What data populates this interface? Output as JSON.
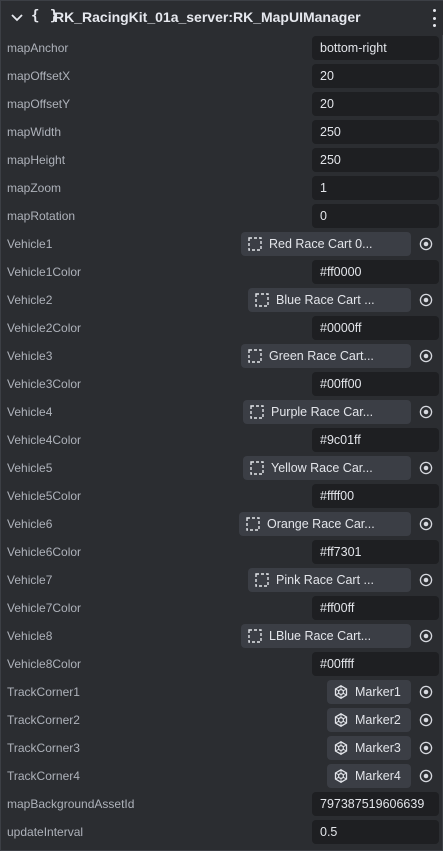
{
  "header": {
    "icon": "chevron-down-icon",
    "braces": "{ }",
    "title": "RK_RacingKit_01a_server:RK_MapUIManager",
    "menu_icon": "kebab-menu-icon"
  },
  "properties": [
    {
      "label": "mapAnchor",
      "kind": "text",
      "value": "bottom-right"
    },
    {
      "label": "mapOffsetX",
      "kind": "text",
      "value": "20"
    },
    {
      "label": "mapOffsetY",
      "kind": "text",
      "value": "20"
    },
    {
      "label": "mapWidth",
      "kind": "text",
      "value": "250"
    },
    {
      "label": "mapHeight",
      "kind": "text",
      "value": "250"
    },
    {
      "label": "mapZoom",
      "kind": "text",
      "value": "1"
    },
    {
      "label": "mapRotation",
      "kind": "text",
      "value": "0"
    },
    {
      "label": "Vehicle1",
      "kind": "entity",
      "value": "Red Race Cart 0...",
      "icon": "entity-icon"
    },
    {
      "label": "Vehicle1Color",
      "kind": "text",
      "value": "#ff0000"
    },
    {
      "label": "Vehicle2",
      "kind": "entity",
      "value": "Blue Race Cart ...",
      "icon": "entity-icon"
    },
    {
      "label": "Vehicle2Color",
      "kind": "text",
      "value": "#0000ff"
    },
    {
      "label": "Vehicle3",
      "kind": "entity",
      "value": "Green Race Cart...",
      "icon": "entity-icon"
    },
    {
      "label": "Vehicle3Color",
      "kind": "text",
      "value": "#00ff00"
    },
    {
      "label": "Vehicle4",
      "kind": "entity",
      "value": "Purple Race Car...",
      "icon": "entity-icon"
    },
    {
      "label": "Vehicle4Color",
      "kind": "text",
      "value": "#9c01ff"
    },
    {
      "label": "Vehicle5",
      "kind": "entity",
      "value": "Yellow Race Car...",
      "icon": "entity-icon"
    },
    {
      "label": "Vehicle5Color",
      "kind": "text",
      "value": "#ffff00"
    },
    {
      "label": "Vehicle6",
      "kind": "entity",
      "value": "Orange Race Car...",
      "icon": "entity-icon"
    },
    {
      "label": "Vehicle6Color",
      "kind": "text",
      "value": "#ff7301"
    },
    {
      "label": "Vehicle7",
      "kind": "entity",
      "value": "Pink Race Cart ...",
      "icon": "entity-icon"
    },
    {
      "label": "Vehicle7Color",
      "kind": "text",
      "value": "#ff00ff"
    },
    {
      "label": "Vehicle8",
      "kind": "entity",
      "value": "LBlue Race Cart...",
      "icon": "entity-icon"
    },
    {
      "label": "Vehicle8Color",
      "kind": "text",
      "value": "#00ffff"
    },
    {
      "label": "TrackCorner1",
      "kind": "marker",
      "value": "Marker1",
      "icon": "marker-icon"
    },
    {
      "label": "TrackCorner2",
      "kind": "marker",
      "value": "Marker2",
      "icon": "marker-icon"
    },
    {
      "label": "TrackCorner3",
      "kind": "marker",
      "value": "Marker3",
      "icon": "marker-icon"
    },
    {
      "label": "TrackCorner4",
      "kind": "marker",
      "value": "Marker4",
      "icon": "marker-icon"
    },
    {
      "label": "mapBackgroundAssetId",
      "kind": "text",
      "value": "797387519606639"
    },
    {
      "label": "updateInterval",
      "kind": "text",
      "value": "0.5"
    }
  ],
  "icons": {
    "picker": "target-icon"
  },
  "colors": {
    "panel_bg": "#2b2d31",
    "field_bg": "#1e1f22",
    "chip_bg": "#3b3e45",
    "label_text": "#aeb2ba",
    "value_text": "#e3e5ea"
  }
}
